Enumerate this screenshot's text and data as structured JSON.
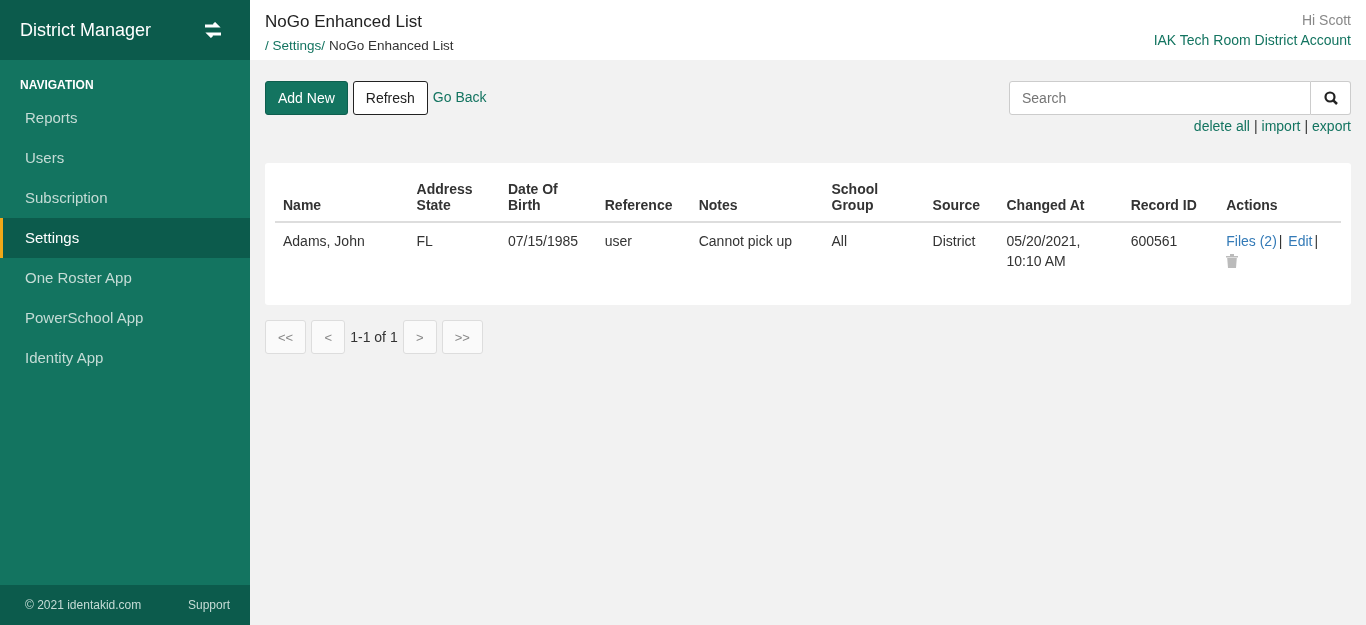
{
  "sidebar": {
    "title": "District Manager",
    "section": "NAVIGATION",
    "items": [
      {
        "label": "Reports",
        "selected": false
      },
      {
        "label": "Users",
        "selected": false
      },
      {
        "label": "Subscription",
        "selected": false
      },
      {
        "label": "Settings",
        "selected": true
      },
      {
        "label": "One Roster App",
        "selected": false
      },
      {
        "label": "PowerSchool App",
        "selected": false
      },
      {
        "label": "Identity App",
        "selected": false
      }
    ],
    "footer": {
      "copyright": "© 2021 identakid.com",
      "support": "Support"
    }
  },
  "header": {
    "title": "NoGo Enhanced List",
    "breadcrumb": [
      {
        "label": "/ Settings/",
        "kind": "link"
      },
      {
        "label": "NoGo Enhanced List",
        "kind": "text"
      }
    ],
    "greeting": "Hi Scott",
    "account": "IAK Tech Room District Account"
  },
  "toolbar": {
    "add": "Add New",
    "refresh": "Refresh",
    "back": "Go Back",
    "search": {
      "placeholder": "Search"
    },
    "links": [
      "delete all",
      "import",
      "export"
    ],
    "separator": "|"
  },
  "table": {
    "columns": [
      "Name",
      "Address State",
      "Date Of Birth",
      "Reference",
      "Notes",
      "School Group",
      "Source",
      "Changed At",
      "Record ID",
      "Actions"
    ],
    "action_separator": "|",
    "rows": [
      {
        "cells": [
          "Adams, John",
          "FL",
          "07/15/1985",
          "user",
          "Cannot pick up",
          "All",
          "District",
          "05/20/2021, 10:10 AM",
          "600561"
        ],
        "actions": [
          {
            "kind": "link",
            "label": "Files (2)"
          },
          {
            "kind": "link",
            "label": "Edit"
          },
          {
            "kind": "delete"
          }
        ]
      }
    ]
  },
  "pager": {
    "first": "<<",
    "prev": "<",
    "info": "1-1 of 1",
    "next": ">",
    "last": ">>"
  }
}
